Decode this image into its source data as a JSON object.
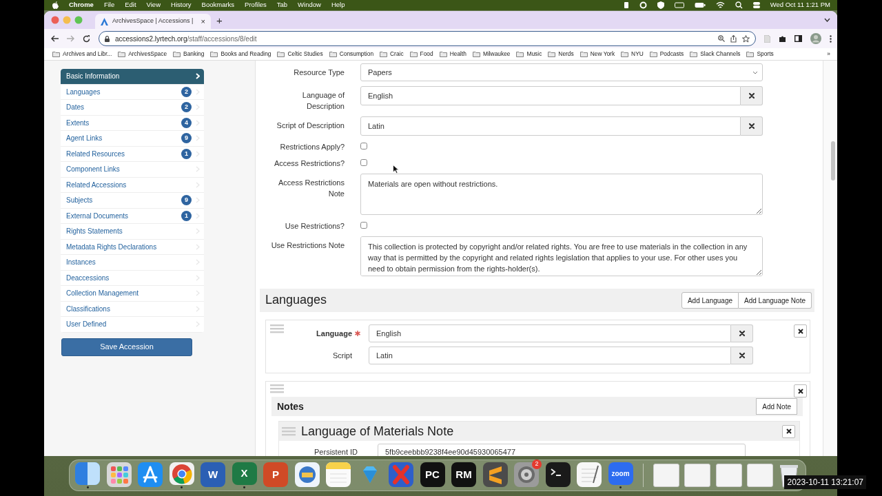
{
  "menu_bar": {
    "app": "Chrome",
    "menus": [
      "File",
      "Edit",
      "View",
      "History",
      "Bookmarks",
      "Profiles",
      "Tab",
      "Window",
      "Help"
    ],
    "clock": "Wed Oct 11 1:21 PM"
  },
  "browser": {
    "tab": {
      "title": "ArchivesSpace | Accessions |",
      "close": "×"
    },
    "new_tab": "+",
    "address": {
      "host": "accessions2.lyrtech.org",
      "path": "/staff/accessions/8/edit"
    },
    "bookmarks": [
      "Archives and Libr...",
      "ArchivesSpace",
      "Banking",
      "Books and Reading",
      "Celtic Studies",
      "Consumption",
      "Craic",
      "Food",
      "Health",
      "Milwaukee",
      "Music",
      "Nerds",
      "New York",
      "NYU",
      "Podcasts",
      "Slack Channels",
      "Sports"
    ],
    "bookmarks_more": "»"
  },
  "sidebar": {
    "items": [
      {
        "label": "Basic Information",
        "selected": true
      },
      {
        "label": "Languages",
        "count": "2",
        "selected": false
      },
      {
        "label": "Dates",
        "count": "2",
        "selected": false
      },
      {
        "label": "Extents",
        "count": "4",
        "selected": false
      },
      {
        "label": "Agent Links",
        "count": "9",
        "selected": false
      },
      {
        "label": "Related Resources",
        "count": "1",
        "selected": false
      },
      {
        "label": "Component Links",
        "selected": false
      },
      {
        "label": "Related Accessions",
        "selected": false
      },
      {
        "label": "Subjects",
        "count": "9",
        "selected": false
      },
      {
        "label": "External Documents",
        "count": "1",
        "selected": false
      },
      {
        "label": "Rights Statements",
        "selected": false
      },
      {
        "label": "Metadata Rights Declarations",
        "selected": false
      },
      {
        "label": "Instances",
        "selected": false
      },
      {
        "label": "Deaccessions",
        "selected": false
      },
      {
        "label": "Collection Management",
        "selected": false
      },
      {
        "label": "Classifications",
        "selected": false
      },
      {
        "label": "User Defined",
        "selected": false
      }
    ],
    "save_button": "Save Accession"
  },
  "form": {
    "rows": [
      {
        "kind": "select",
        "label": "Resource Type",
        "value": "Papers"
      },
      {
        "kind": "lookup",
        "label": "Language of Description",
        "value": "English"
      },
      {
        "kind": "lookup",
        "label": "Script of Description",
        "value": "Latin"
      },
      {
        "kind": "checkbox",
        "label": "Restrictions Apply?",
        "checked": false
      },
      {
        "kind": "checkbox",
        "label": "Access Restrictions?",
        "checked": false
      },
      {
        "kind": "textarea",
        "label": "Access Restrictions Note",
        "value": "Materials are open without restrictions."
      },
      {
        "kind": "checkbox",
        "label": "Use Restrictions?",
        "checked": false
      },
      {
        "kind": "textarea",
        "label": "Use Restrictions Note",
        "value": "This collection is protected by copyright and/or related rights. You are free to use materials in the collection in any way that is permitted by the copyright and related rights legislation that applies to your use. For other uses you need to obtain permission from the rights-holder(s)."
      }
    ]
  },
  "languages": {
    "title": "Languages",
    "buttons": [
      "Add Language",
      "Add Language Note"
    ],
    "language": {
      "rows": [
        {
          "label": "Language",
          "required": true,
          "value": "English"
        },
        {
          "label": "Script",
          "required": false,
          "value": "Latin"
        }
      ]
    },
    "notes": {
      "title": "Notes",
      "add_button": "Add Note",
      "note": {
        "title": "Language of Materials Note",
        "rows": [
          {
            "label": "Persistent ID",
            "value": "5fb9ceebbb9238f4ee90d45930065477"
          }
        ]
      }
    }
  },
  "dock": {
    "apps": [
      {
        "kind": "finder",
        "running": true
      },
      {
        "kind": "grid",
        "running": false
      },
      {
        "kind": "store",
        "running": false
      },
      {
        "kind": "browser",
        "running": true
      },
      {
        "kind": "letter",
        "label": "W",
        "color": "#2b5fb4",
        "running": false
      },
      {
        "kind": "letter",
        "label": "X",
        "color": "#1f7a45",
        "running": true
      },
      {
        "kind": "letter",
        "label": "P",
        "color": "#d04a26",
        "running": false
      },
      {
        "kind": "stamp",
        "running": false
      },
      {
        "kind": "notes",
        "running": false
      },
      {
        "kind": "gem",
        "running": false
      },
      {
        "kind": "cross",
        "running": false
      },
      {
        "kind": "letter",
        "label": "PC",
        "color": "#111111",
        "running": false
      },
      {
        "kind": "letter",
        "label": "RM",
        "color": "#111111",
        "running": false
      },
      {
        "kind": "sublime",
        "running": false
      },
      {
        "kind": "gear",
        "badge": "2",
        "running": false
      },
      {
        "kind": "terminal",
        "running": false
      },
      {
        "kind": "paper",
        "running": false
      },
      {
        "kind": "letter",
        "label": "zoom",
        "color": "#2d6cf0",
        "running": true
      }
    ],
    "documents": [
      {
        "kind": "document"
      },
      {
        "kind": "document"
      },
      {
        "kind": "document"
      },
      {
        "kind": "document"
      }
    ]
  },
  "recording_timestamp": "2023-10-11 13:21:07"
}
